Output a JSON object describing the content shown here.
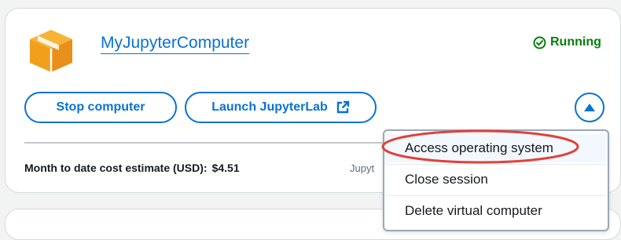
{
  "card": {
    "title": "MyJupyterComputer",
    "status": {
      "label": "Running",
      "color": "#037f0c"
    },
    "buttons": {
      "stop_label": "Stop computer",
      "launch_label": "Launch JupyterLab"
    },
    "cost": {
      "label": "Month to date cost estimate (USD):",
      "value": "$4.51"
    },
    "obscured_text": "Jupyt"
  },
  "menu": {
    "items": [
      {
        "label": "Access operating system"
      },
      {
        "label": "Close session"
      },
      {
        "label": "Delete virtual computer"
      }
    ]
  },
  "icons": {
    "logo": "box-cube-icon",
    "status": "check-circle-icon",
    "launch": "external-link-icon",
    "toggle": "caret-up-icon"
  },
  "colors": {
    "accent": "#0972d3",
    "success": "#037f0c",
    "logo": "#f4a523",
    "annotation": "#e0413b"
  }
}
